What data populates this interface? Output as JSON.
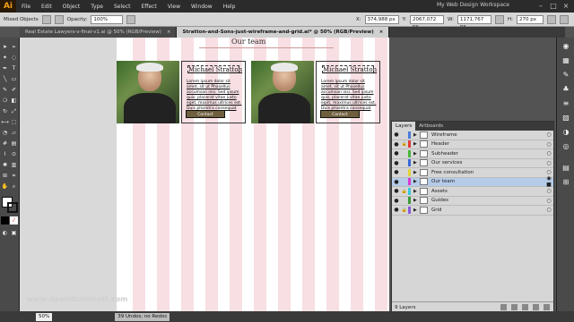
{
  "app": {
    "logo": "Ai",
    "workspace": "My Web Design Workspace"
  },
  "menu": [
    "File",
    "Edit",
    "Object",
    "Type",
    "Select",
    "Effect",
    "View",
    "Window",
    "Help"
  ],
  "control": {
    "selection_label": "Mixed Objects",
    "opacity_label": "Opacity:",
    "opacity_value": "100%",
    "x_label": "X:",
    "x_value": "374,988 px",
    "y_label": "Y:",
    "y_value": "2067,072 px",
    "w_label": "W:",
    "w_value": "1171,767 px",
    "h_label": "H:",
    "h_value": "270 px"
  },
  "tabs": [
    {
      "label": "Real Estate Lawyers-v-final-v1.ai @ 50% (RGB/Preview)",
      "close": "×"
    },
    {
      "label": "Stratton-and-Sons-just-wireframe-and-grid.ai* @ 50% (RGB/Preview)",
      "close": "×"
    }
  ],
  "artboard": {
    "section_title": "Our team"
  },
  "cards": [
    {
      "name": "Michael Stratton",
      "text": "Lorem ipsum dolor sit amet, sit ut Phasellus accumsan nisi. Sed ipsum quis, placerat vitae justo eget, maximus ultrices est. Duis pharetra consequat nibh.",
      "button": "Contact"
    },
    {
      "name": "Michael Stratton",
      "text": "Lorem ipsum dolor sit amet, sit ut Phasellus accumsan nisi. Sed ipsum quis, placerat vitae justo eget, maximus ultrices est. Duis pharetra consequat nibh.",
      "button": "Contact"
    }
  ],
  "layers_panel": {
    "tabs": [
      "Layers",
      "Artboards"
    ],
    "layers": [
      {
        "name": "Wireframe",
        "color": "#4d7bd9",
        "locked": false,
        "selected": false
      },
      {
        "name": "Header",
        "color": "#e23a3a",
        "locked": true,
        "selected": false
      },
      {
        "name": "Subheader",
        "color": "#49b63a",
        "locked": false,
        "selected": false
      },
      {
        "name": "Our services",
        "color": "#3a68d9",
        "locked": false,
        "selected": false
      },
      {
        "name": "Free consultation",
        "color": "#e0d53a",
        "locked": false,
        "selected": false
      },
      {
        "name": "Our team",
        "color": "#d93ad0",
        "locked": false,
        "selected": true
      },
      {
        "name": "Assets",
        "color": "#3ac7d9",
        "locked": true,
        "selected": false
      },
      {
        "name": "Guides",
        "color": "#3a9a3a",
        "locked": false,
        "selected": false
      },
      {
        "name": "Grid",
        "color": "#8a5ad9",
        "locked": true,
        "selected": false
      }
    ],
    "footer": "9 Layers"
  },
  "status": {
    "zoom": "50%",
    "undo": "39 Undos; no Redos"
  },
  "watermark": "www.dawidtuminski.com"
}
